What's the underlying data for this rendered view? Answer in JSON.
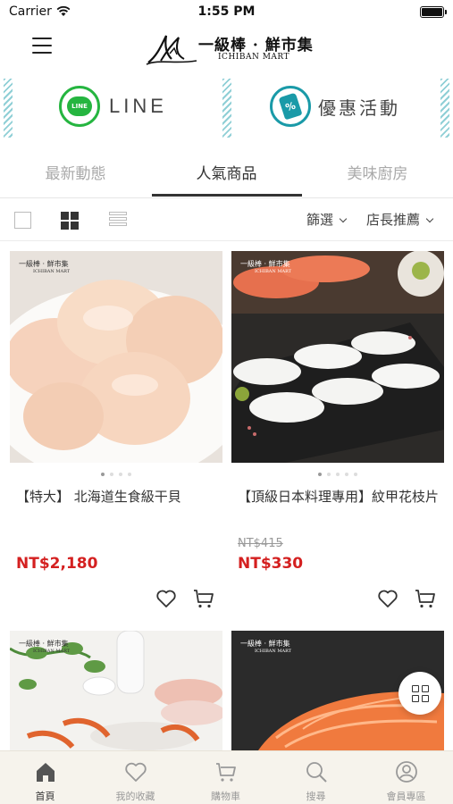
{
  "status_bar": {
    "carrier": "Carrier",
    "time": "1:55 PM"
  },
  "header": {
    "logo_cn": "一級棒 · 鮮市集",
    "logo_en": "ICHIBAN MART"
  },
  "banner": {
    "line_icon_text": "LINE",
    "line_label": "LINE",
    "promo_icon_text": "%",
    "promo_label": "優惠活動",
    "accent_line": "#25b540",
    "accent_promo": "#1a9aa8"
  },
  "tabs": [
    {
      "label": "最新動態",
      "active": false
    },
    {
      "label": "人氣商品",
      "active": true
    },
    {
      "label": "美味廚房",
      "active": false
    }
  ],
  "toolbar": {
    "filter_label": "篩選",
    "sort_label": "店長推薦"
  },
  "products": [
    {
      "title": "【特大】 北海道生食級干貝",
      "old_price": "",
      "price": "NT$2,180",
      "brand_cn": "一級棒 · 鮮市集",
      "brand_en": "ICHIBAN MART",
      "image_dots": 4,
      "active_dot": 1
    },
    {
      "title": "【頂級日本料理專用】紋甲花枝片",
      "old_price": "NT$415",
      "price": "NT$330",
      "brand_cn": "一級棒 · 鮮市集",
      "brand_en": "ICHIBAN MART",
      "image_dots": 5,
      "active_dot": 1
    },
    {
      "brand_cn": "一級棒 · 鮮市集",
      "brand_en": "ICHIBAN MART"
    },
    {
      "brand_cn": "一級棒 · 鮮市集",
      "brand_en": "ICHIBAN MART"
    }
  ],
  "bottom_nav": [
    {
      "label": "首頁",
      "icon": "home-icon",
      "active": true
    },
    {
      "label": "我的收藏",
      "icon": "heart-icon",
      "active": false
    },
    {
      "label": "購物車",
      "icon": "cart-icon",
      "active": false
    },
    {
      "label": "搜尋",
      "icon": "search-icon",
      "active": false
    },
    {
      "label": "會員專區",
      "icon": "user-icon",
      "active": false
    }
  ],
  "colors": {
    "price": "#d42020",
    "nav_bg": "#f6f3ec"
  }
}
